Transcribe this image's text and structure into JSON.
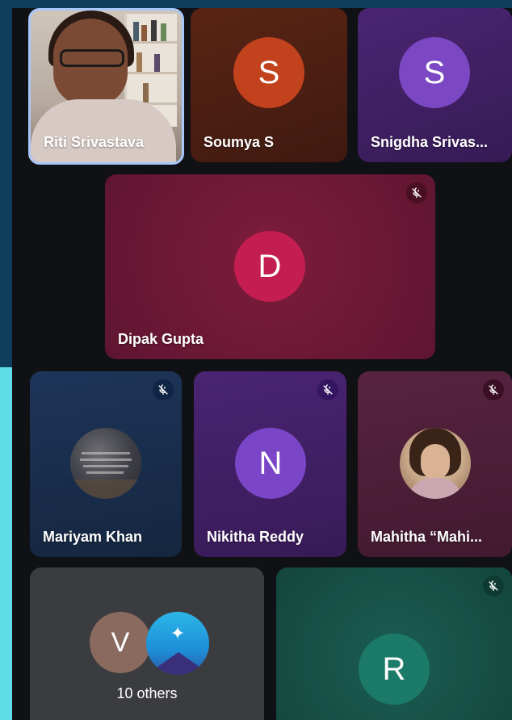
{
  "participants": {
    "riti": {
      "name": "Riti Srivastava"
    },
    "soumya": {
      "name": "Soumya S",
      "initial": "S",
      "avatar_color": "#c2421e"
    },
    "snigdha": {
      "name": "Snigdha Srivas...",
      "initial": "S",
      "avatar_color": "#7b47c2"
    },
    "dipak": {
      "name": "Dipak Gupta",
      "initial": "D",
      "avatar_color": "#c41d52",
      "muted": true
    },
    "mariyam": {
      "name": "Mariyam Khan",
      "muted": true
    },
    "nikitha": {
      "name": "Nikitha Reddy",
      "initial": "N",
      "avatar_color": "#7b45c7",
      "muted": true
    },
    "mahitha": {
      "name": "Mahitha “Mahi...",
      "muted": true
    },
    "others": {
      "label": "10 others",
      "initial": "V",
      "avatar_color": "#8a6a5e"
    },
    "r": {
      "initial": "R",
      "avatar_color": "#1b7a68",
      "muted": true
    }
  },
  "icons": {
    "mute": "mic-off-icon"
  }
}
